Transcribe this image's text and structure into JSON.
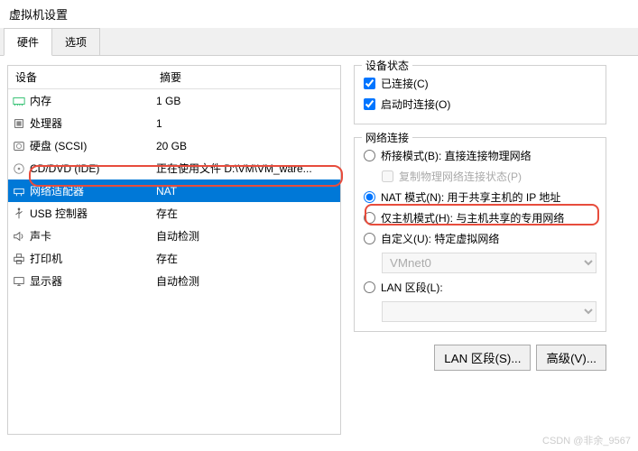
{
  "window_title": "虚拟机设置",
  "tabs": {
    "hardware": "硬件",
    "options": "选项"
  },
  "headers": {
    "device": "设备",
    "summary": "摘要"
  },
  "devices": [
    {
      "icon": "memory-icon",
      "label": "内存",
      "summary": "1 GB"
    },
    {
      "icon": "cpu-icon",
      "label": "处理器",
      "summary": "1"
    },
    {
      "icon": "disk-icon",
      "label": "硬盘 (SCSI)",
      "summary": "20 GB"
    },
    {
      "icon": "disc-icon",
      "label": "CD/DVD (IDE)",
      "summary": "正在使用文件 D:\\VM\\VM_ware..."
    },
    {
      "icon": "network-icon",
      "label": "网络适配器",
      "summary": "NAT"
    },
    {
      "icon": "usb-icon",
      "label": "USB 控制器",
      "summary": "存在"
    },
    {
      "icon": "sound-icon",
      "label": "声卡",
      "summary": "自动检测"
    },
    {
      "icon": "printer-icon",
      "label": "打印机",
      "summary": "存在"
    },
    {
      "icon": "display-icon",
      "label": "显示器",
      "summary": "自动检测"
    }
  ],
  "status_group": {
    "title": "设备状态",
    "connected": "已连接(C)",
    "connect_on_start": "启动时连接(O)"
  },
  "net_group": {
    "title": "网络连接",
    "bridge": "桥接模式(B): 直接连接物理网络",
    "replicate": "复制物理网络连接状态(P)",
    "nat": "NAT 模式(N): 用于共享主机的 IP 地址",
    "hostonly": "仅主机模式(H): 与主机共享的专用网络",
    "custom": "自定义(U): 特定虚拟网络",
    "vmnet": "VMnet0",
    "lan_seg_radio": "LAN 区段(L):"
  },
  "buttons": {
    "lan_seg": "LAN 区段(S)...",
    "advanced": "高级(V)..."
  },
  "watermark": "CSDN @非余_9567"
}
